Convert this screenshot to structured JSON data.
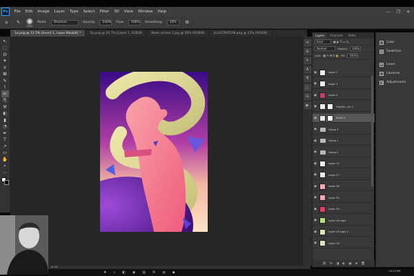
{
  "app": {
    "logo": "Ps"
  },
  "menu": [
    "File",
    "Edit",
    "Image",
    "Layer",
    "Type",
    "Select",
    "Filter",
    "3D",
    "View",
    "Window",
    "Help"
  ],
  "window_controls": [
    "—",
    "❐",
    "✕"
  ],
  "options": {
    "brush_size": "2500",
    "mode_label": "Mode:",
    "mode_value": "Dissolve",
    "opacity_label": "Opacity:",
    "opacity_value": "100%",
    "flow_label": "Flow:",
    "flow_value": "100%",
    "smoothing_label": "Smoothing:",
    "smoothing_value": "10%"
  },
  "doc_tabs": [
    {
      "label": "1a.png @ 12.5% (Invert 1, Layer Mask/8) *",
      "active": true
    },
    {
      "label": "1b.png @ 16.7% (Layer 1, RGB/8)",
      "active": false
    },
    {
      "label": "Node screen 1.jpg @ 50% (RGB/8)",
      "active": false
    },
    {
      "label": "ILLUSTRATION.png @ 33% (RGB/8)",
      "active": false
    }
  ],
  "tools": [
    "↖",
    "⬚",
    "ʘ",
    "✦",
    "⌗",
    "⊠",
    "✎",
    "⌇",
    "✏",
    "⎘",
    "⚒",
    "◐",
    "▮",
    "◔",
    "✒",
    "T",
    "↗",
    "▭",
    "✋",
    "⌕",
    "⋯"
  ],
  "layers_panel": {
    "tabs": [
      {
        "label": "Layers",
        "active": true
      },
      {
        "label": "Channels",
        "active": false
      },
      {
        "label": "Paths",
        "active": false
      }
    ],
    "kind_placeholder": "Kind",
    "blend_mode": "Normal",
    "opacity_label": "Opacity:",
    "opacity_value": "100%",
    "lock_label": "Lock:",
    "fill_label": "Fill:",
    "fill_value": "100%",
    "layers": [
      {
        "name": "Layer 2",
        "type": "layer",
        "thumb": "#ececec",
        "selected": false
      },
      {
        "name": "Layer 3",
        "type": "layer",
        "thumb": "#ececec",
        "selected": false
      },
      {
        "name": "Layer 4",
        "type": "layer",
        "thumb": "#c23c6a",
        "selected": false
      },
      {
        "name": "Hue/Sa...ion 1",
        "type": "adjustment",
        "thumb": "#ececec",
        "selected": false
      },
      {
        "name": "Invert 1",
        "type": "adjustment",
        "thumb": "#ececec",
        "selected": true
      },
      {
        "name": "Group 3",
        "type": "group",
        "selected": false
      },
      {
        "name": "Group 1",
        "type": "group",
        "selected": false
      },
      {
        "name": "Group 2",
        "type": "group",
        "selected": false
      },
      {
        "name": "Layer 11",
        "type": "layer",
        "thumb": "#ececec",
        "selected": false
      },
      {
        "name": "Layer 27",
        "type": "layer",
        "thumb": "#ececec",
        "selected": false
      },
      {
        "name": "Layer 28",
        "type": "layer",
        "thumb": "#f2a7b4",
        "selected": false
      },
      {
        "name": "Layer 30",
        "type": "layer",
        "thumb": "#f2a7b4",
        "selected": false
      },
      {
        "name": "Layer 29",
        "type": "layer",
        "thumb": "#e33d66",
        "selected": false
      },
      {
        "name": "Layer 26 copy",
        "type": "layer",
        "thumb": "#b8e07a",
        "selected": false
      },
      {
        "name": "Layer 26 copy 2",
        "type": "layer",
        "thumb": "#d8e3b7",
        "selected": false
      },
      {
        "name": "Layer 26",
        "type": "layer",
        "thumb": "#d8e3b7",
        "selected": false
      }
    ],
    "footer_icons": [
      "⛓",
      "fx",
      "◨",
      "◐",
      "▣",
      "⊞",
      "🗑"
    ]
  },
  "right_panel": [
    {
      "label": "Color",
      "icon": "◎"
    },
    {
      "label": "Swatches",
      "icon": "▦"
    },
    {
      "label": "Learn",
      "icon": "✚"
    },
    {
      "label": "Libraries",
      "icon": "◫"
    },
    {
      "label": "Adjustments",
      "icon": "◑"
    }
  ],
  "status": "12.5%",
  "taskbar": {
    "icons": [
      "❖",
      "⌕",
      "◧",
      "◉",
      "▥",
      "✉",
      "◍",
      "◆"
    ],
    "clock": "10:25 PM"
  },
  "colors": {
    "accent": "#2fa3f6",
    "canvas_purple": "#3b0a8a",
    "canvas_pink": "#f06a8c",
    "canvas_yellow": "#e7e3a4"
  }
}
